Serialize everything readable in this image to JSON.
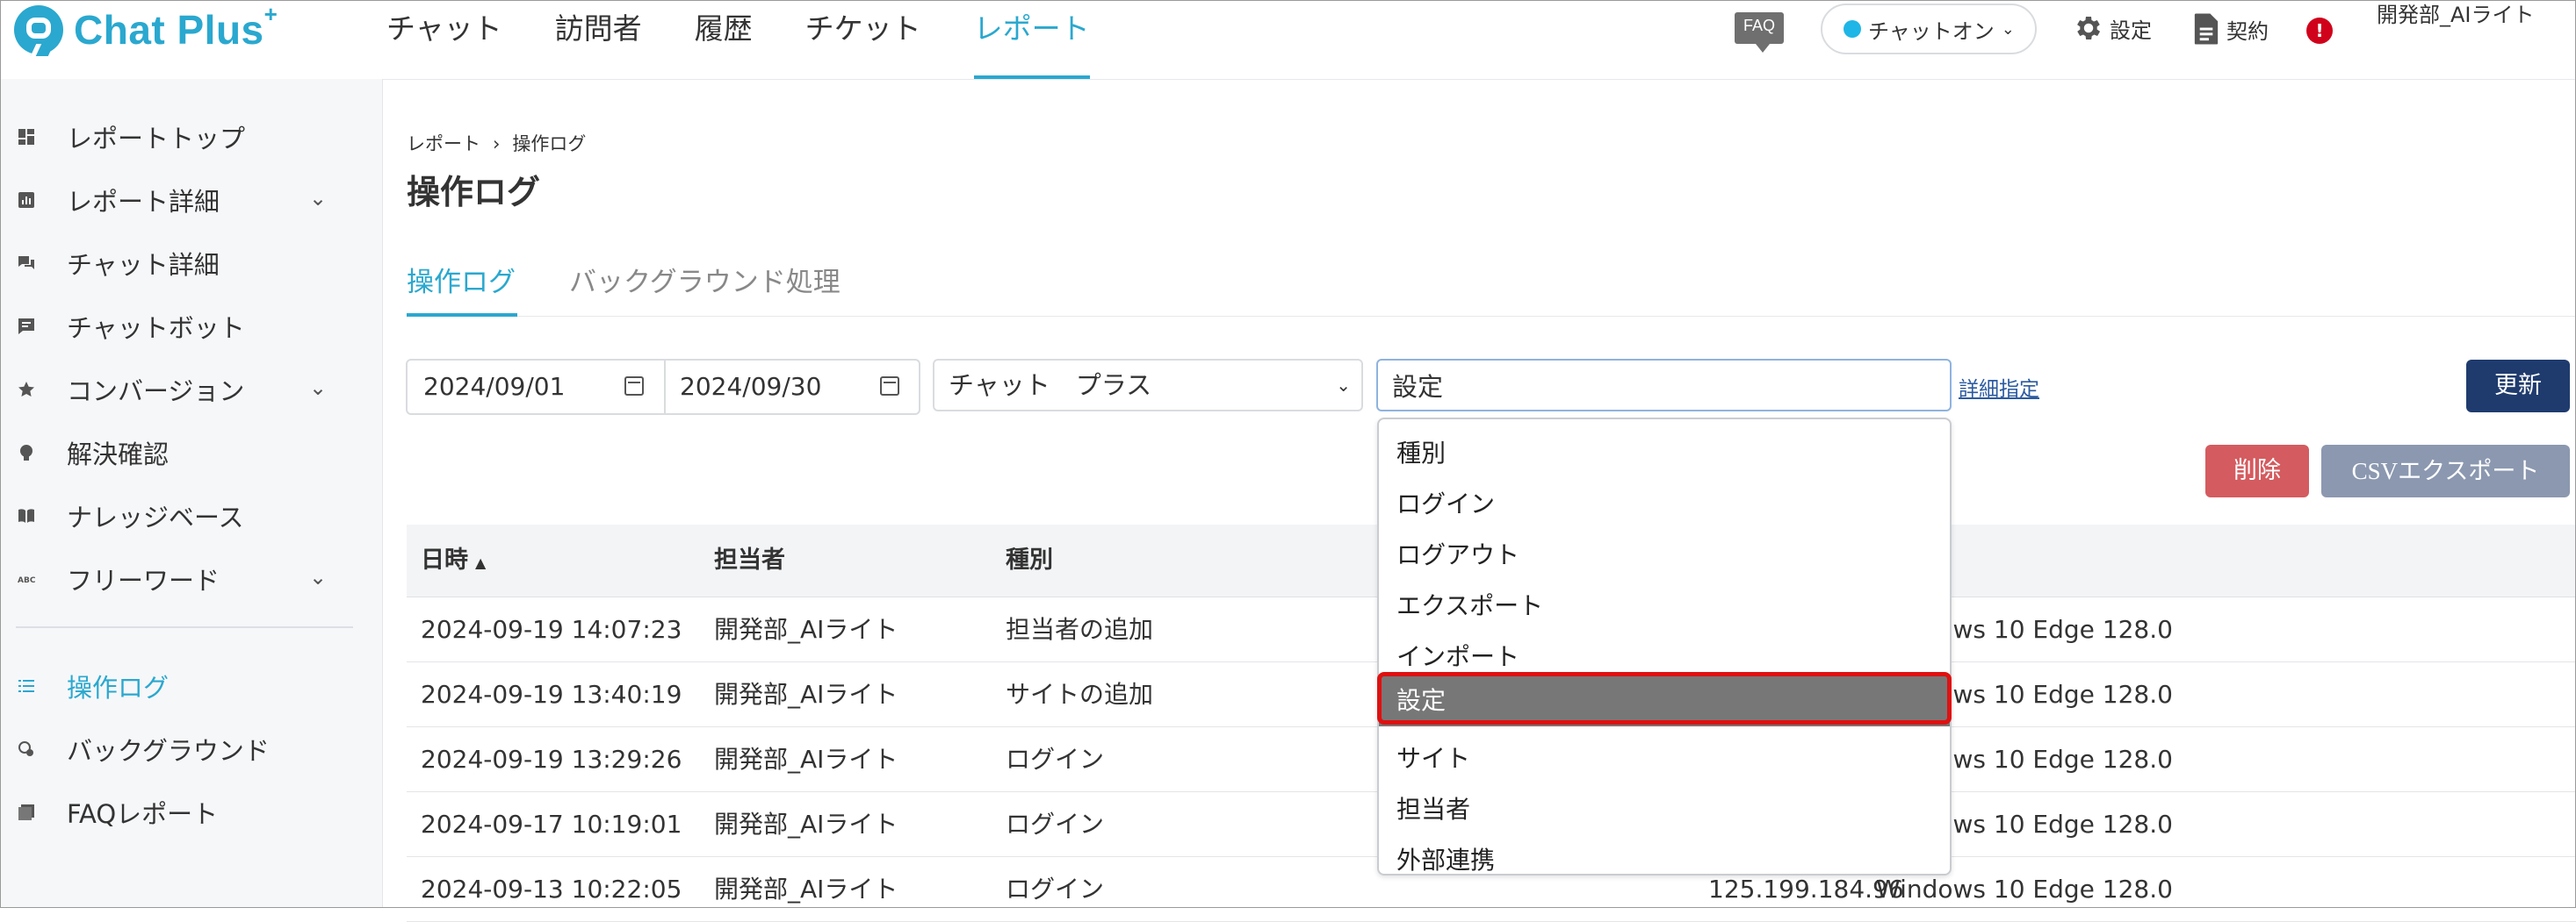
{
  "header": {
    "logo_text": "Chat Plus",
    "logo_sup": "+",
    "nav": [
      {
        "label": "チャット"
      },
      {
        "label": "訪問者"
      },
      {
        "label": "履歴"
      },
      {
        "label": "チケット"
      },
      {
        "label": "レポート",
        "active": true
      }
    ],
    "faq_label": "FAQ",
    "chat_status": "チャットオン",
    "settings_label": "設定",
    "contract_label": "契約",
    "alert_label": "!",
    "user_name": "開発部_AIライト"
  },
  "sidebar": {
    "items": [
      {
        "label": "レポートトップ",
        "icon": "dashboard-icon"
      },
      {
        "label": "レポート詳細",
        "icon": "report-icon",
        "expandable": true
      },
      {
        "label": "チャット詳細",
        "icon": "chat-bubbles-icon"
      },
      {
        "label": "チャットボット",
        "icon": "chatbot-icon"
      },
      {
        "label": "コンバージョン",
        "icon": "star-icon",
        "expandable": true
      },
      {
        "label": "解決確認",
        "icon": "lightbulb-icon"
      },
      {
        "label": "ナレッジベース",
        "icon": "book-icon"
      },
      {
        "label": "フリーワード",
        "icon": "abc-icon",
        "expandable": true
      },
      {
        "label": "操作ログ",
        "icon": "list-icon",
        "active": true
      },
      {
        "label": "バックグラウンド",
        "icon": "background-icon"
      },
      {
        "label": "FAQレポート",
        "icon": "faq-report-icon"
      }
    ]
  },
  "breadcrumb": {
    "parent": "レポート",
    "sep": "›",
    "current": "操作ログ"
  },
  "page_title": "操作ログ",
  "tabs": [
    {
      "label": "操作ログ",
      "active": true
    },
    {
      "label": "バックグラウンド処理"
    }
  ],
  "filters": {
    "date_from": "2024/09/01",
    "date_to": "2024/09/30",
    "site_select": "チャット　プラス",
    "type_value": "設定",
    "detail_link": "詳細指定",
    "update_label": "更新",
    "delete_label": "削除",
    "csv_label": "CSVエクスポート"
  },
  "table": {
    "headers": [
      "日時",
      "担当者",
      "種別"
    ],
    "sort_indicator": "▲",
    "rows": [
      {
        "datetime": "2024-09-19 14:07:23",
        "user": "開発部_AIライト",
        "type": "担当者の追加",
        "ip": "",
        "browser": "Windows 10 Edge 128.0"
      },
      {
        "datetime": "2024-09-19 13:40:19",
        "user": "開発部_AIライト",
        "type": "サイトの追加",
        "ip": "",
        "browser": "Windows 10 Edge 128.0"
      },
      {
        "datetime": "2024-09-19 13:29:26",
        "user": "開発部_AIライト",
        "type": "ログイン",
        "ip": "",
        "browser": "Windows 10 Edge 128.0"
      },
      {
        "datetime": "2024-09-17 10:19:01",
        "user": "開発部_AIライト",
        "type": "ログイン",
        "ip": "",
        "browser": "Windows 10 Edge 128.0"
      },
      {
        "datetime": "2024-09-13 10:22:05",
        "user": "開発部_AIライト",
        "type": "ログイン",
        "ip": "125.199.184.96",
        "browser": "Windows 10 Edge 128.0"
      }
    ]
  },
  "dropdown": {
    "options": [
      {
        "label": "種別"
      },
      {
        "label": "ログイン"
      },
      {
        "label": "ログアウト"
      },
      {
        "label": "エクスポート"
      },
      {
        "label": "インポート"
      },
      {
        "label": "設定",
        "selected": true
      },
      {
        "label": "サイト"
      },
      {
        "label": "担当者"
      },
      {
        "label": "外部連携"
      }
    ]
  },
  "colors": {
    "brand": "#2aa8cf",
    "update_button": "#1f3b6e",
    "delete_button": "#d45b5f",
    "csv_button": "#8b98b0",
    "selected_option": "#777777",
    "highlight": "#e01010"
  }
}
